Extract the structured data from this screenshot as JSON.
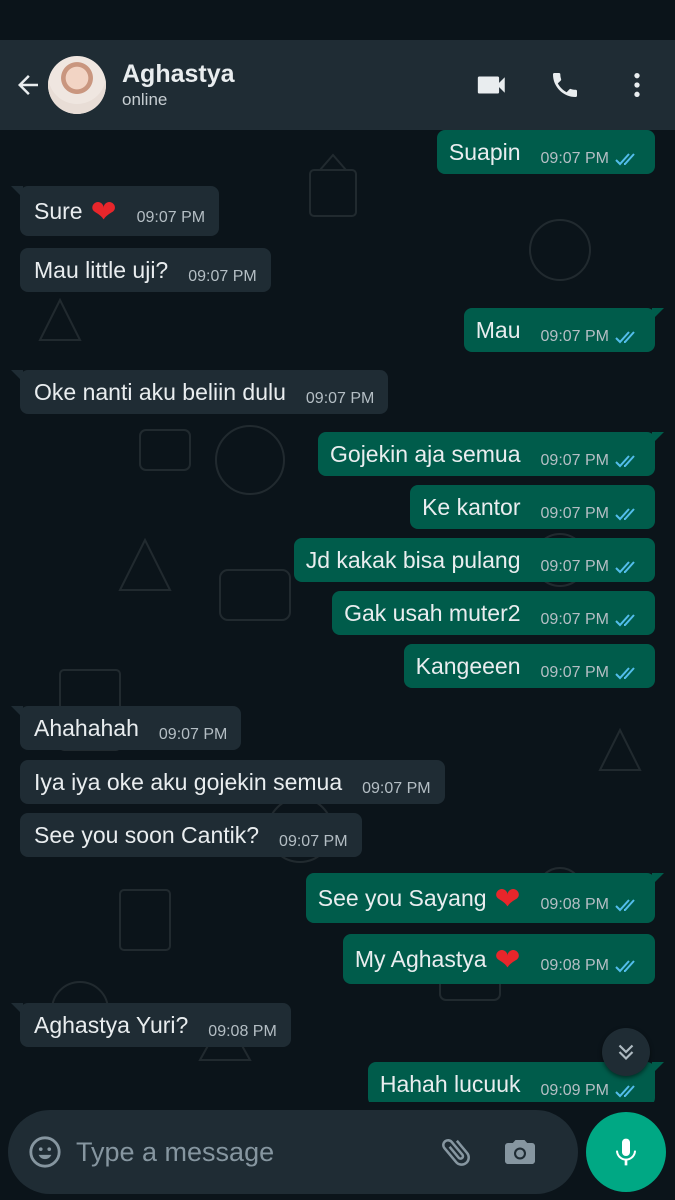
{
  "header": {
    "contact_name": "Aghastya",
    "contact_status": "online"
  },
  "icons": {
    "back": "arrow-left-icon",
    "video_call": "video-camera-icon",
    "voice_call": "phone-icon",
    "menu": "more-vertical-icon",
    "scroll_down": "double-chevron-down-icon",
    "emoji": "emoji-icon",
    "attach": "paperclip-icon",
    "camera": "camera-icon",
    "mic": "microphone-icon",
    "read_receipt": "double-check-icon"
  },
  "colors": {
    "background": "#0b141a",
    "header": "#1f2c34",
    "incoming_bubble": "#1f2c34",
    "outgoing_bubble": "#005c4b",
    "read_ticks": "#53bdeb",
    "mic_button": "#00a884",
    "heart": "#e8262b"
  },
  "messages": [
    {
      "direction": "out",
      "text": "Suapin",
      "time": "09:07 PM",
      "read": true
    },
    {
      "direction": "in",
      "text": "Sure",
      "emoji": "❤",
      "time": "09:07 PM"
    },
    {
      "direction": "in",
      "text": "Mau little uji?",
      "time": "09:07 PM"
    },
    {
      "direction": "out",
      "text": "Mau",
      "time": "09:07 PM",
      "read": true
    },
    {
      "direction": "in",
      "text": "Oke nanti aku beliin dulu",
      "time": "09:07 PM"
    },
    {
      "direction": "out",
      "text": "Gojekin aja semua",
      "time": "09:07 PM",
      "read": true
    },
    {
      "direction": "out",
      "text": "Ke kantor",
      "time": "09:07 PM",
      "read": true
    },
    {
      "direction": "out",
      "text": "Jd kakak bisa pulang",
      "time": "09:07 PM",
      "read": true
    },
    {
      "direction": "out",
      "text": "Gak usah muter2",
      "time": "09:07 PM",
      "read": true
    },
    {
      "direction": "out",
      "text": "Kangeeen",
      "time": "09:07 PM",
      "read": true
    },
    {
      "direction": "in",
      "text": "Ahahahah",
      "time": "09:07 PM"
    },
    {
      "direction": "in",
      "text": "Iya iya oke aku gojekin semua",
      "time": "09:07 PM"
    },
    {
      "direction": "in",
      "text": "See you soon Cantik?",
      "time": "09:07 PM"
    },
    {
      "direction": "out",
      "text": "See you Sayang",
      "emoji": "❤",
      "time": "09:08 PM",
      "read": true
    },
    {
      "direction": "out",
      "text": "My Aghastya",
      "emoji": "❤",
      "time": "09:08 PM",
      "read": true
    },
    {
      "direction": "in",
      "text": "Aghastya Yuri?",
      "time": "09:08 PM"
    },
    {
      "direction": "out",
      "text": "Hahah lucuuk",
      "time": "09:09 PM",
      "read": true
    }
  ],
  "composer": {
    "placeholder": "Type a message"
  }
}
